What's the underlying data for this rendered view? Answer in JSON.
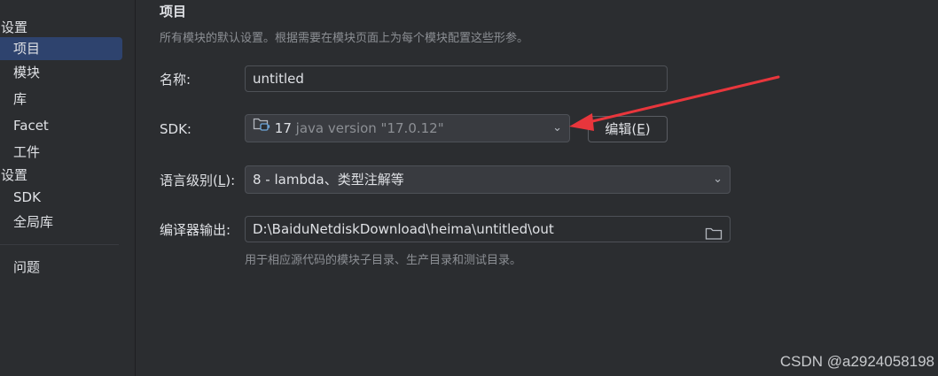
{
  "sidebar": {
    "group_project": "目设置",
    "items_project": [
      "项目",
      "模块",
      "库",
      "Facet",
      "工件"
    ],
    "group_platform": "台设置",
    "items_platform": [
      "SDK",
      "全局库"
    ],
    "problems": "问题",
    "selected": "项目"
  },
  "main": {
    "title": "项目",
    "subtitle": "所有模块的默认设置。根据需要在模块页面上为每个模块配置这些形参。",
    "name_label": "名称:",
    "name_value": "untitled",
    "sdk_label": "SDK:",
    "sdk_version": "17",
    "sdk_detail": "java version \"17.0.12\"",
    "edit_button_prefix": "编辑(",
    "edit_button_mnemonic": "E",
    "edit_button_suffix": ")",
    "lang_label_prefix": "语言级别(",
    "lang_label_mnemonic": "L",
    "lang_label_suffix": "):",
    "lang_value": "8 - lambda、类型注解等",
    "output_label": "编译器输出:",
    "output_value": "D:\\BaiduNetdiskDownload\\heima\\untitled\\out",
    "output_hint": "用于相应源代码的模块子目录、生产目录和测试目录。"
  },
  "watermark": "CSDN @a2924058198",
  "colors": {
    "background": "#2b2d30",
    "selection": "#2e436e",
    "annotation_arrow": "#e8363c"
  }
}
